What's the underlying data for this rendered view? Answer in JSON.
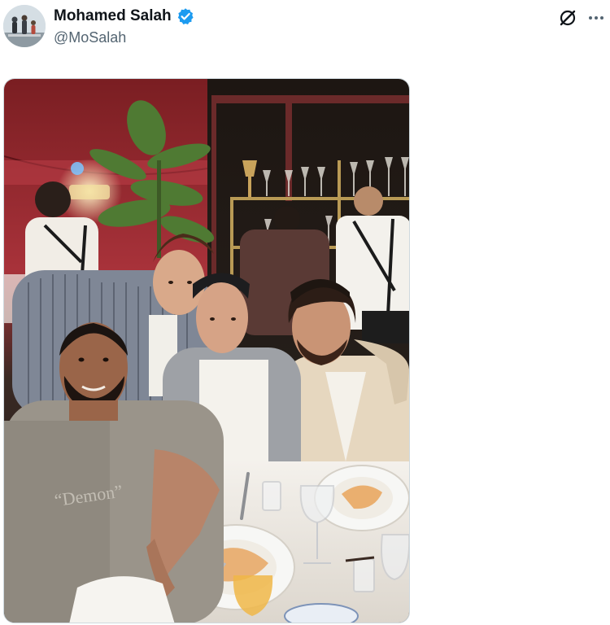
{
  "post": {
    "author": {
      "display_name": "Mohamed Salah",
      "handle": "@MoSalah",
      "verified": true,
      "avatar_icon": "avatar-photo"
    },
    "actions": {
      "grok_icon": "grok-icon",
      "more_icon": "more-options-icon"
    },
    "media": {
      "type": "photo",
      "icon": "photo-restaurant-group",
      "shirt_text": "“Demon”"
    },
    "colors": {
      "verified_blue": "#1d9bf0",
      "name_text": "#0f1419",
      "handle_text": "#536471"
    }
  }
}
